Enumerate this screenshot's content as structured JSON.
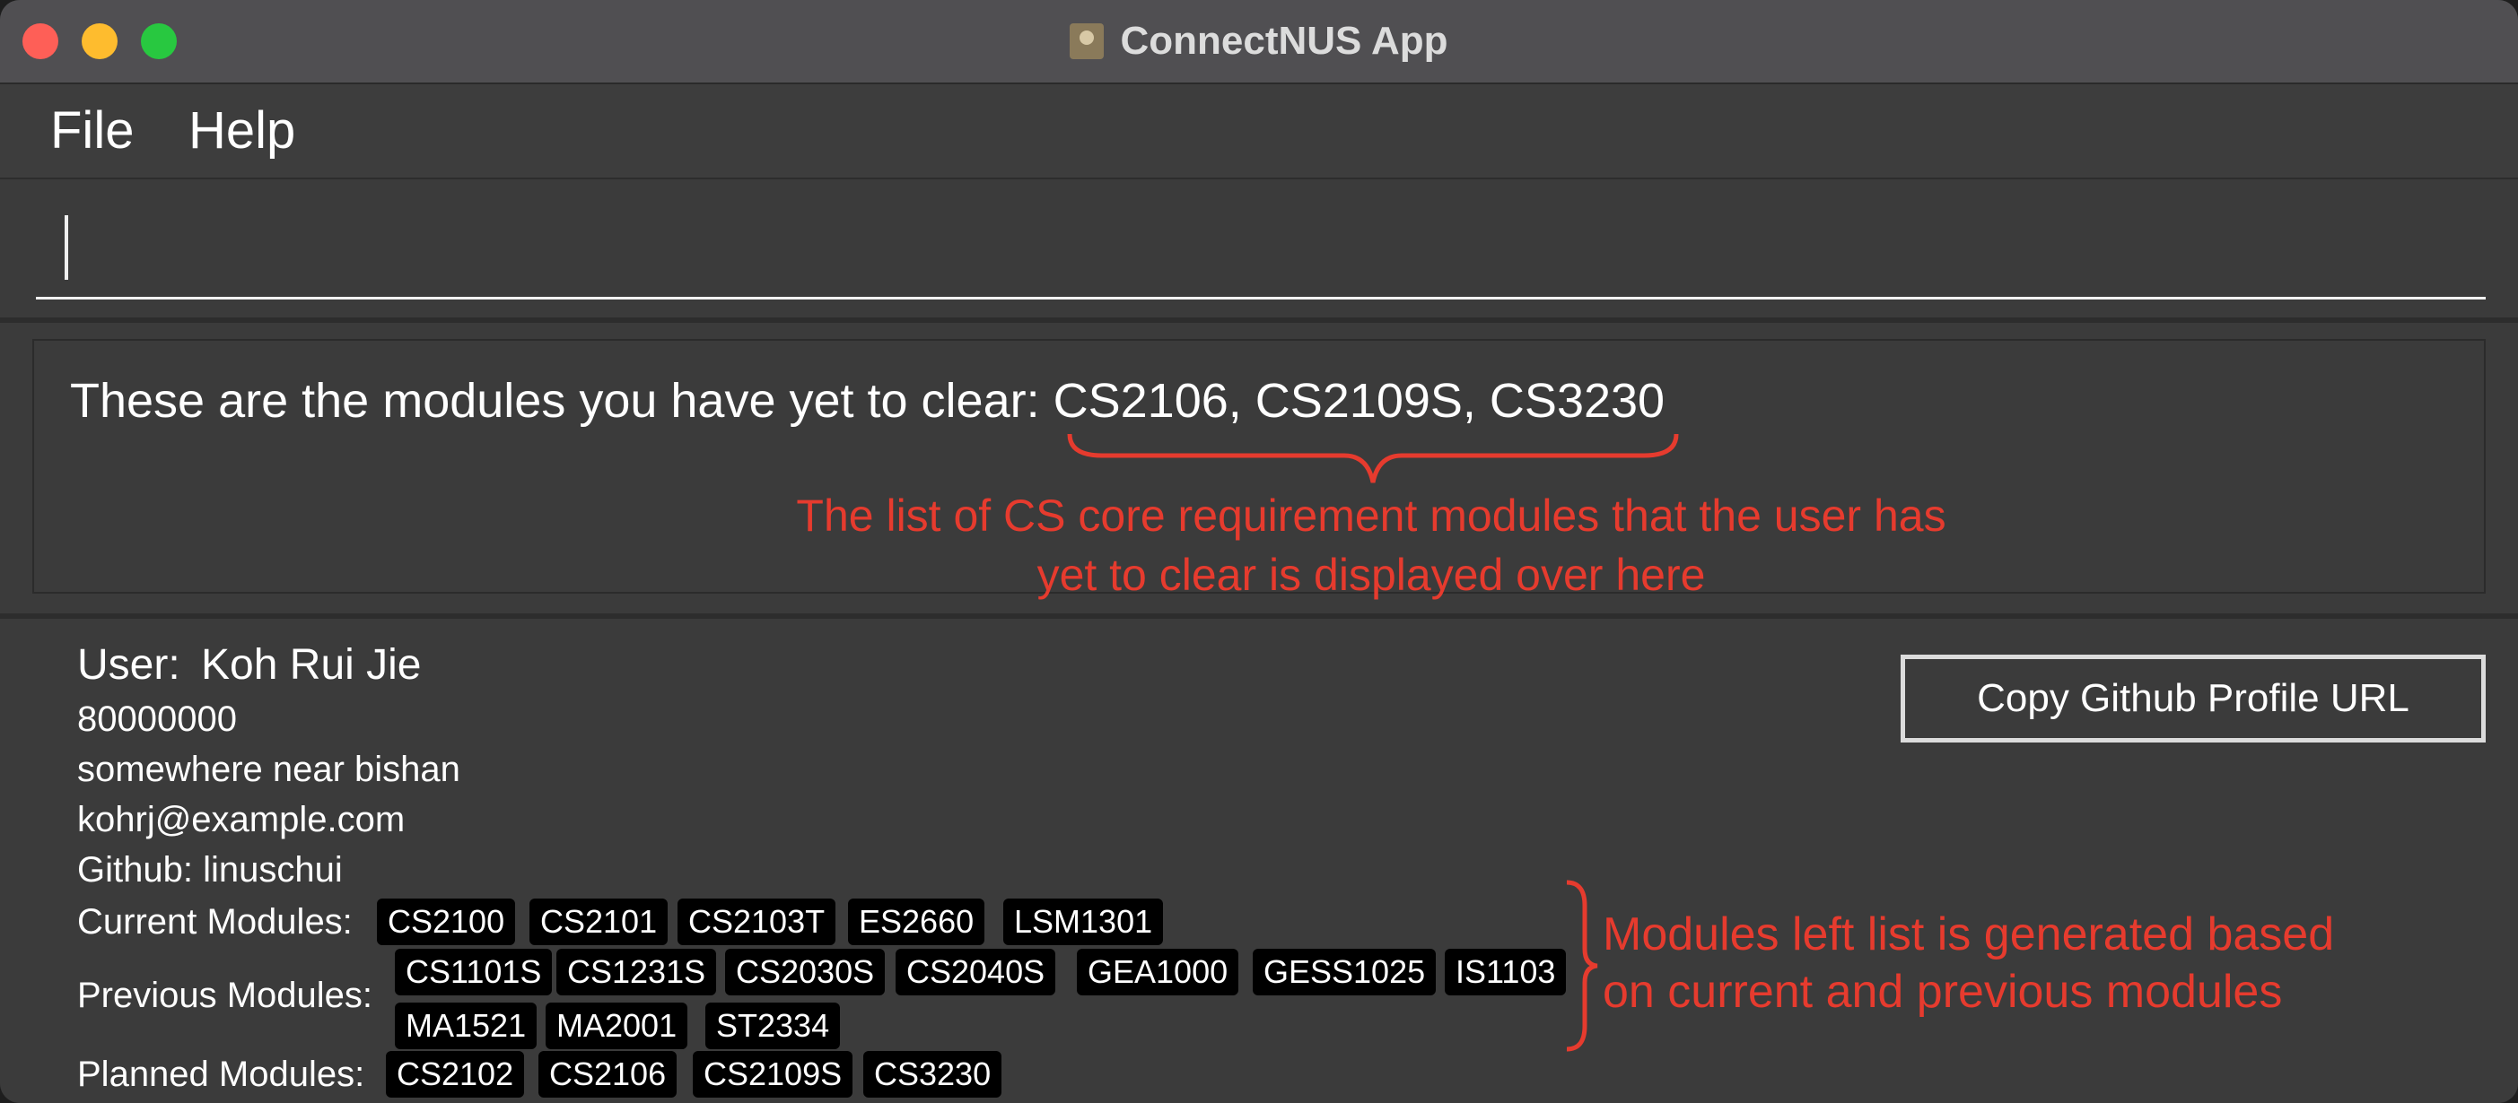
{
  "window": {
    "title": "ConnectNUS App"
  },
  "menu": {
    "items": [
      "File",
      "Help"
    ]
  },
  "command": {
    "value": ""
  },
  "result": {
    "text": "These are the modules you have yet to clear: CS2106, CS2109S, CS3230"
  },
  "annotations": {
    "result_note_line1": "The list of CS core requirement modules that the user has",
    "result_note_line2": "yet to clear is displayed over here",
    "modules_note_line1": "Modules left list is generated based",
    "modules_note_line2": "on current and previous modules",
    "color": "#e63b2e"
  },
  "person": {
    "user_label": "User:",
    "name": "Koh Rui Jie",
    "phone": "80000000",
    "address": "somewhere near bishan",
    "email": "kohrj@example.com",
    "github": "Github: linuschui",
    "copy_button": "Copy Github Profile URL",
    "current_label": "Current Modules:",
    "current_modules": [
      "CS2100",
      "CS2101",
      "CS2103T",
      "ES2660",
      "LSM1301"
    ],
    "previous_label": "Previous Modules:",
    "previous_modules_row1": [
      "CS1101S",
      "CS1231S",
      "CS2030S",
      "CS2040S",
      "GEA1000",
      "GESS1025",
      "IS1103"
    ],
    "previous_modules_row2": [
      "MA1521",
      "MA2001",
      "ST2334"
    ],
    "planned_label": "Planned Modules:",
    "planned_modules": [
      "CS2102",
      "CS2106",
      "CS2109S",
      "CS3230"
    ]
  },
  "colors": {
    "background": "#3b3b3b",
    "titlebar": "#504f52",
    "chip": "#000000",
    "annotation": "#e63b2e"
  }
}
